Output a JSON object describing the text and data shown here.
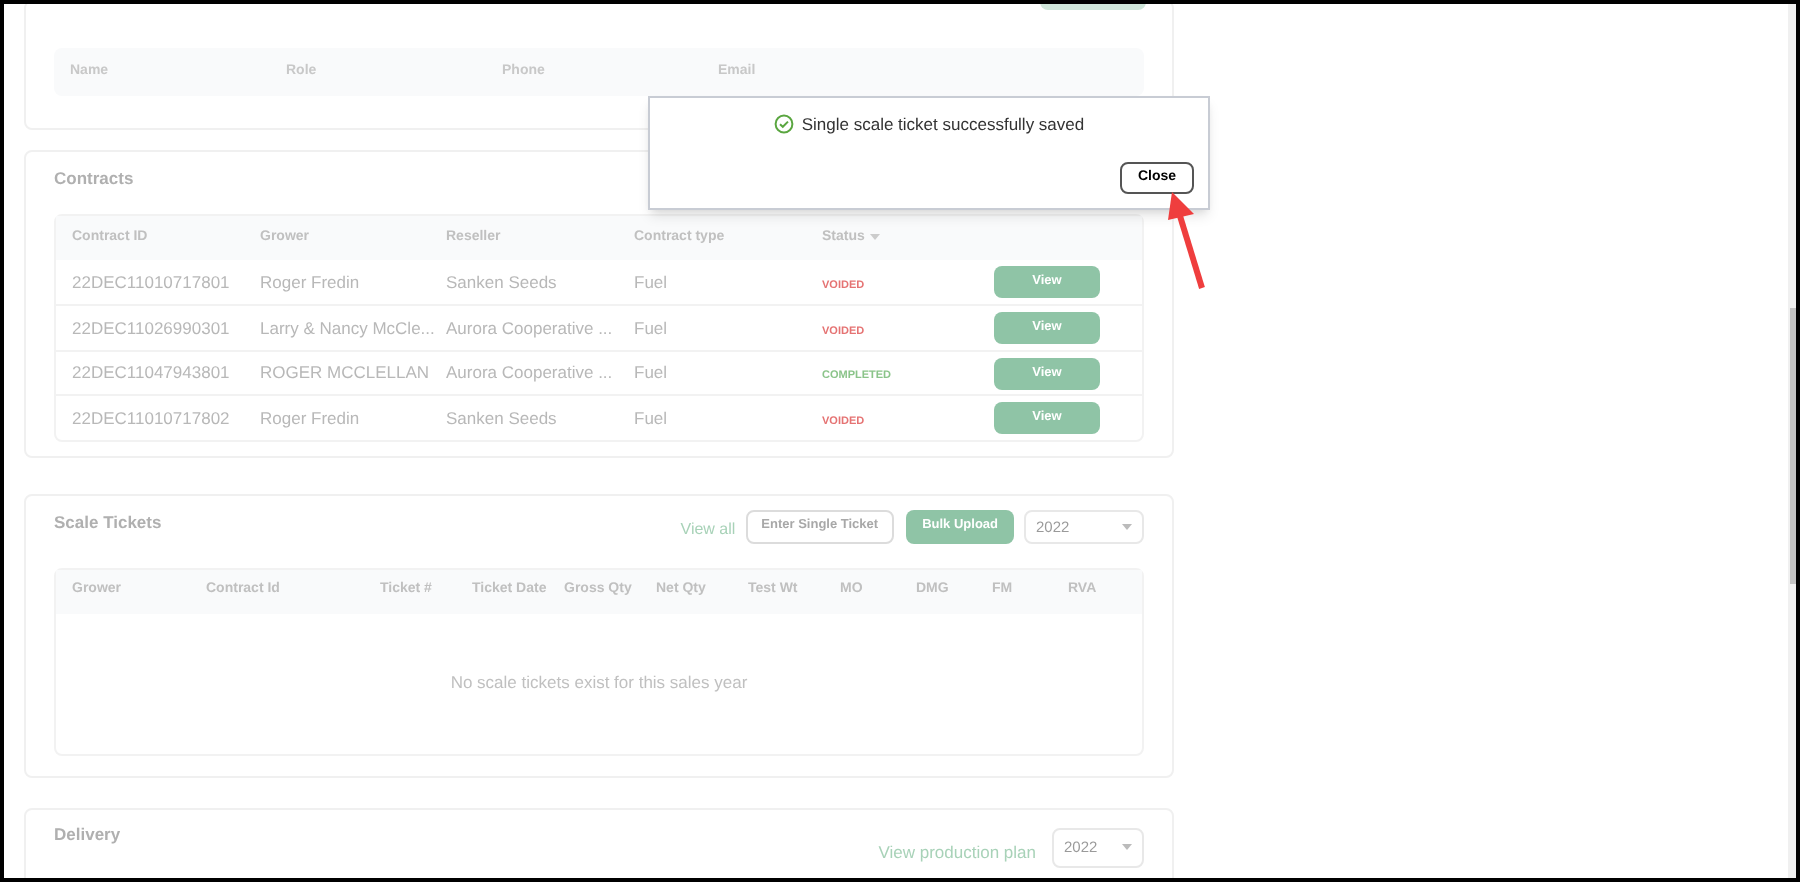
{
  "contacts_table": {
    "columns": [
      "Name",
      "Role",
      "Phone",
      "Email"
    ]
  },
  "contracts": {
    "title": "Contracts",
    "columns": [
      "Contract ID",
      "Grower",
      "Reseller",
      "Contract type",
      "Status"
    ],
    "rows": [
      {
        "contract_id": "22DEC11010717801",
        "grower": "Roger Fredin",
        "reseller": "Sanken Seeds",
        "contract_type": "Fuel",
        "status": "VOIDED",
        "color": "#e57373",
        "action": "View"
      },
      {
        "contract_id": "22DEC11026990301",
        "grower": "Larry & Nancy McCle...",
        "reseller": "Aurora Cooperative ...",
        "contract_type": "Fuel",
        "status": "VOIDED",
        "color": "#e57373",
        "action": "View"
      },
      {
        "contract_id": "22DEC11047943801",
        "grower": "ROGER MCCLELLAN",
        "reseller": "Aurora Cooperative ...",
        "contract_type": "Fuel",
        "status": "COMPLETED",
        "color": "#8bc48a",
        "action": "View"
      },
      {
        "contract_id": "22DEC11010717802",
        "grower": "Roger Fredin",
        "reseller": "Sanken Seeds",
        "contract_type": "Fuel",
        "status": "VOIDED",
        "color": "#e57373",
        "action": "View"
      }
    ]
  },
  "scale_tickets": {
    "title": "Scale Tickets",
    "view_all": "View all",
    "enter_button": "Enter Single Ticket",
    "bulk_button": "Bulk Upload",
    "year": "2022",
    "columns": [
      "Grower",
      "Contract Id",
      "Ticket #",
      "Ticket Date",
      "Gross Qty",
      "Net Qty",
      "Test Wt",
      "MO",
      "DMG",
      "FM",
      "RVA"
    ],
    "empty_message": "No scale tickets exist for this sales year"
  },
  "delivery": {
    "title": "Delivery",
    "link": "View production plan",
    "year": "2022"
  },
  "dialog": {
    "message": "Single scale ticket successfully saved",
    "button": "Close"
  }
}
